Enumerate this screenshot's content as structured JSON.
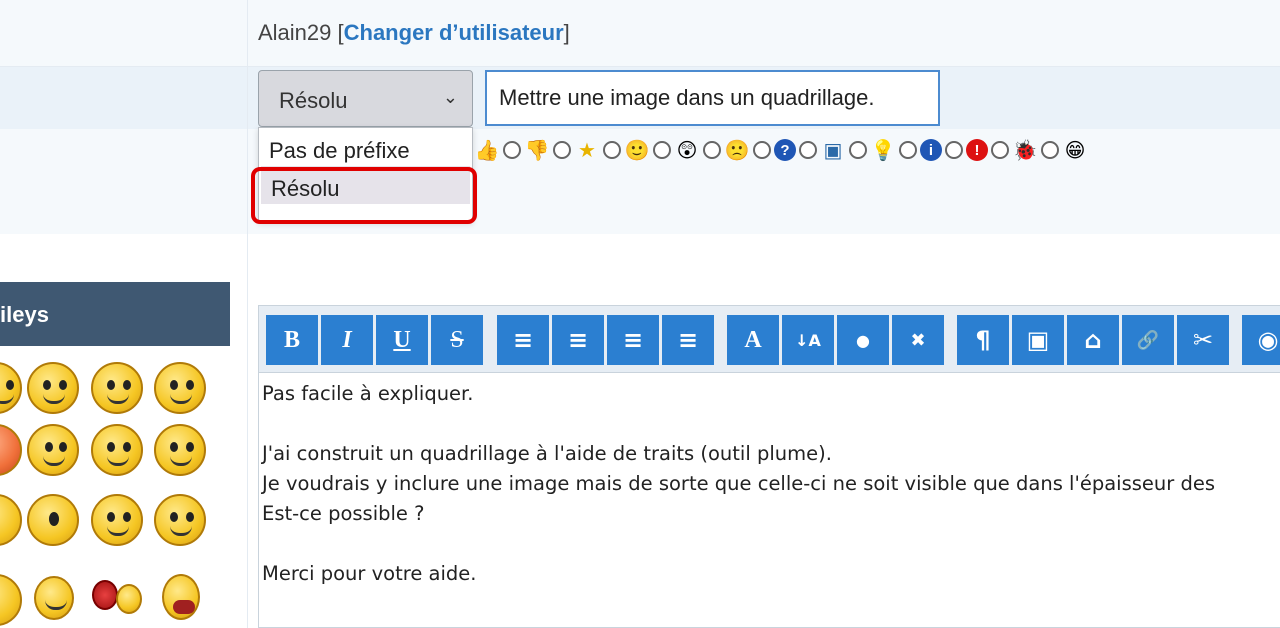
{
  "header": {
    "username": "Alain29",
    "change_user_open": " [",
    "change_user_link": "Changer d’utilisateur",
    "change_user_close": "]"
  },
  "prefix": {
    "selected": "Résolu",
    "options": [
      "Pas de préfixe",
      "Résolu"
    ]
  },
  "topic_title": {
    "value": "Mettre une image dans un quadrillage."
  },
  "message_icons": [
    "thumbs-up-icon",
    "thumbs-down-icon",
    "star-icon",
    "smile-icon",
    "shocked-icon",
    "sad-icon",
    "question-icon",
    "image-icon",
    "lightbulb-icon",
    "info-icon",
    "exclamation-icon",
    "bug-icon",
    "grin-icon"
  ],
  "smileys": {
    "heading": "ileys"
  },
  "toolbar": {
    "buttons": [
      {
        "name": "bold",
        "label": "B"
      },
      {
        "name": "italic",
        "label": "I"
      },
      {
        "name": "underline",
        "label": "U"
      },
      {
        "name": "strike",
        "label": "S"
      },
      {
        "name": "align-left",
        "label": "≡"
      },
      {
        "name": "align-center",
        "label": "≡"
      },
      {
        "name": "align-right",
        "label": "≡"
      },
      {
        "name": "justify",
        "label": "≡"
      },
      {
        "name": "font",
        "label": "A"
      },
      {
        "name": "font-size",
        "label": "↓A"
      },
      {
        "name": "color",
        "label": "●"
      },
      {
        "name": "remove-format",
        "label": "✖"
      },
      {
        "name": "paragraph",
        "label": "¶"
      },
      {
        "name": "image",
        "label": "▣"
      },
      {
        "name": "hide",
        "label": "⌂"
      },
      {
        "name": "link",
        "label": "🔗"
      },
      {
        "name": "unlink",
        "label": "✂"
      },
      {
        "name": "camera",
        "label": "◉"
      }
    ]
  },
  "editor": {
    "text": "Pas facile à expliquer.\n\nJ'ai construit un quadrillage à l'aide de traits (outil plume).\nJe voudrais y inclure une image mais de sorte que celle-ci ne soit visible que dans l'épaisseur des\nEst-ce possible ?\n\nMerci pour votre aide."
  },
  "colors": {
    "accent": "#2b7fd1",
    "header_dark": "#3f5872",
    "highlight": "#e00000",
    "link": "#2b77c0"
  }
}
